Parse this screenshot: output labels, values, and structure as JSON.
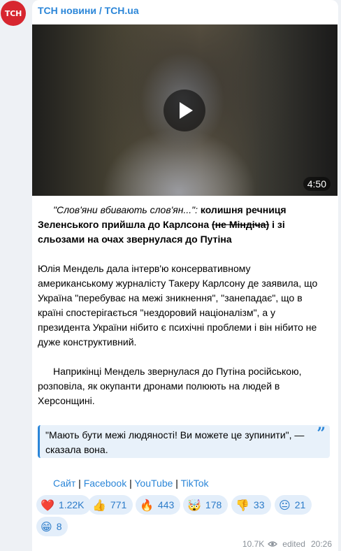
{
  "avatar": {
    "text": "ТСН",
    "color": "#d7262f"
  },
  "channel": {
    "name": "ТСН новини / TCH.ua",
    "color": "#2b86d8"
  },
  "video": {
    "duration": "4:50",
    "play_icon": "play-icon"
  },
  "headline": {
    "quote": "\"Слов'яни вбивають слов'ян...\":",
    "part1": " колишня речниця Зеленського прийшла до Карлсона ",
    "strike": "(не Міндіча)",
    "part2": " і зі сльозами на очах звернулася до Путіна"
  },
  "paragraph1": "Юлія Мендель дала інтерв'ю консервативному американському журналісту Такеру Карлсону де заявила, що Україна \"перебуває на межі зникнення\", \"занепадає\", що в країні спостерігається \"нездоровий націоналізм\", а у президента України нібито є психічні проблеми і він нібито не дуже конструктивний.",
  "paragraph2": "Наприкінці Мендель звернулася до Путіна російською, розповіла, як окупанти дронами полюють на людей в Херсонщині.",
  "blockquote": {
    "text": "\"Мають бути межі людяності! Ви можете це зупинити\", — сказала вона.",
    "icon": "quote-icon"
  },
  "links": {
    "site": "Сайт",
    "facebook": "Facebook",
    "youtube": "YouTube",
    "tiktok": "TikTok",
    "separator": " | "
  },
  "reactions": [
    {
      "emoji": "❤️",
      "count": "1.22K"
    },
    {
      "emoji": "👍",
      "count": "771"
    },
    {
      "emoji": "🔥",
      "count": "443"
    },
    {
      "emoji": "🤯",
      "count": "178"
    },
    {
      "emoji": "👎",
      "count": "33"
    },
    {
      "emoji": "😐",
      "count": "21"
    },
    {
      "emoji": "😁",
      "count": "8"
    }
  ],
  "meta": {
    "views": "10.7K",
    "edited": "edited",
    "time": "20:26"
  }
}
